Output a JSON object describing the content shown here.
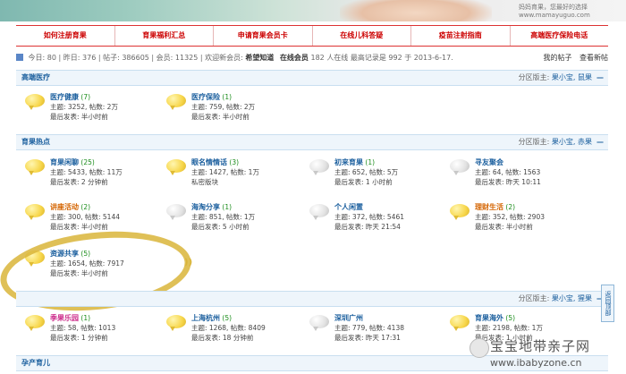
{
  "banner": {
    "url_text": "妈妈育果，您最好的选择\nwww.mamayuguo.com"
  },
  "nav": [
    "如何注册育果",
    "育果福利汇总",
    "申请育果会员卡",
    "在线儿科答疑",
    "疫苗注射指南",
    "高端医疗保险电话"
  ],
  "stats": {
    "today_label": "今日:",
    "today": "80",
    "yesterday_label": "昨日:",
    "yesterday": "376",
    "posts_label": "帖子:",
    "posts": "386605",
    "members_label": "会员:",
    "members": "11325",
    "welcome": "欢迎新会员:",
    "new_member": "希望知道",
    "online_label": "在线会员",
    "online_count": "182",
    "online_text": "人在线 最高记录是",
    "record": "992",
    "record_date": "于 2013-6-17.",
    "my_posts": "我的帖子",
    "new_posts": "查看新帖"
  },
  "sections": [
    {
      "title": "高端医疗",
      "mods_label": "分区版主:",
      "mods": "果小宝, 鼠果",
      "collapse": "—"
    },
    {
      "title": "育果热点",
      "mods_label": "分区版主:",
      "mods": "果小宝, 赤果",
      "collapse": "—"
    },
    {
      "title": "",
      "mods_label": "分区版主:",
      "mods": "果小宝, 猩果",
      "collapse": "—"
    },
    {
      "title": "孕产育儿",
      "mods_label": "",
      "mods": "",
      "collapse": ""
    }
  ],
  "forums": {
    "f1": {
      "name": "医疗健康",
      "today": "(7)",
      "line2": "主题: 3252, 帖数: 2万",
      "line3": "最后发表: 半小时前"
    },
    "f2": {
      "name": "医疗保险",
      "today": "(1)",
      "line2": "主题: 759, 帖数: 2万",
      "line3": "最后发表: 半小时前"
    },
    "f3": {
      "name": "育果闲聊",
      "today": "(25)",
      "line2": "主题: 5433, 帖数: 11万",
      "line3": "最后发表: 2 分钟前"
    },
    "f4": {
      "name": "眼名情情话",
      "today": "(3)",
      "line2": "主题: 1427, 帖数: 1万",
      "line3": "私密版块"
    },
    "f5": {
      "name": "初来育果",
      "today": "(1)",
      "line2": "主题: 652, 帖数: 5万",
      "line3": "最后发表: 1 小时前"
    },
    "f6": {
      "name": "寻友聚会",
      "today": "",
      "line2": "主题: 64, 帖数: 1563",
      "line3": "最后发表: 昨天 10:11"
    },
    "f7": {
      "name": "讲座活动",
      "today": "(2)",
      "line2": "主题: 300, 帖数: 5144",
      "line3": "最后发表: 半小时前"
    },
    "f8": {
      "name": "海淘分享",
      "today": "(1)",
      "line2": "主题: 851, 帖数: 1万",
      "line3": "最后发表: 5 小时前"
    },
    "f9": {
      "name": "个人闲置",
      "today": "",
      "line2": "主题: 372, 帖数: 5461",
      "line3": "最后发表: 昨天 21:54"
    },
    "f10": {
      "name": "理财生活",
      "today": "(2)",
      "line2": "主题: 352, 帖数: 2903",
      "line3": "最后发表: 半小时前"
    },
    "f11": {
      "name": "资源共享",
      "today": "(5)",
      "line2": "主题: 1654, 帖数: 7917",
      "line3": "最后发表: 半小时前"
    },
    "f12": {
      "name": "季果乐园",
      "today": "(1)",
      "line2": "主题: 58, 帖数: 1013",
      "line3": "最后发表: 1 分钟前"
    },
    "f13": {
      "name": "上海杭州",
      "today": "(5)",
      "line2": "主题: 1268, 帖数: 8409",
      "line3": "最后发表: 18 分钟前"
    },
    "f14": {
      "name": "深圳广州",
      "today": "",
      "line2": "主题: 779, 帖数: 4138",
      "line3": "最后发表: 昨天 17:31"
    },
    "f15": {
      "name": "育果海外",
      "today": "(5)",
      "line2": "主题: 2198, 帖数: 1万",
      "line3": "最后发表: 1 小时前"
    }
  },
  "side_tab": "返回顶部",
  "ring_mark": "))",
  "watermark": {
    "line1": "宝宝地带亲子网",
    "line2": "www.ibabyzone.cn"
  }
}
